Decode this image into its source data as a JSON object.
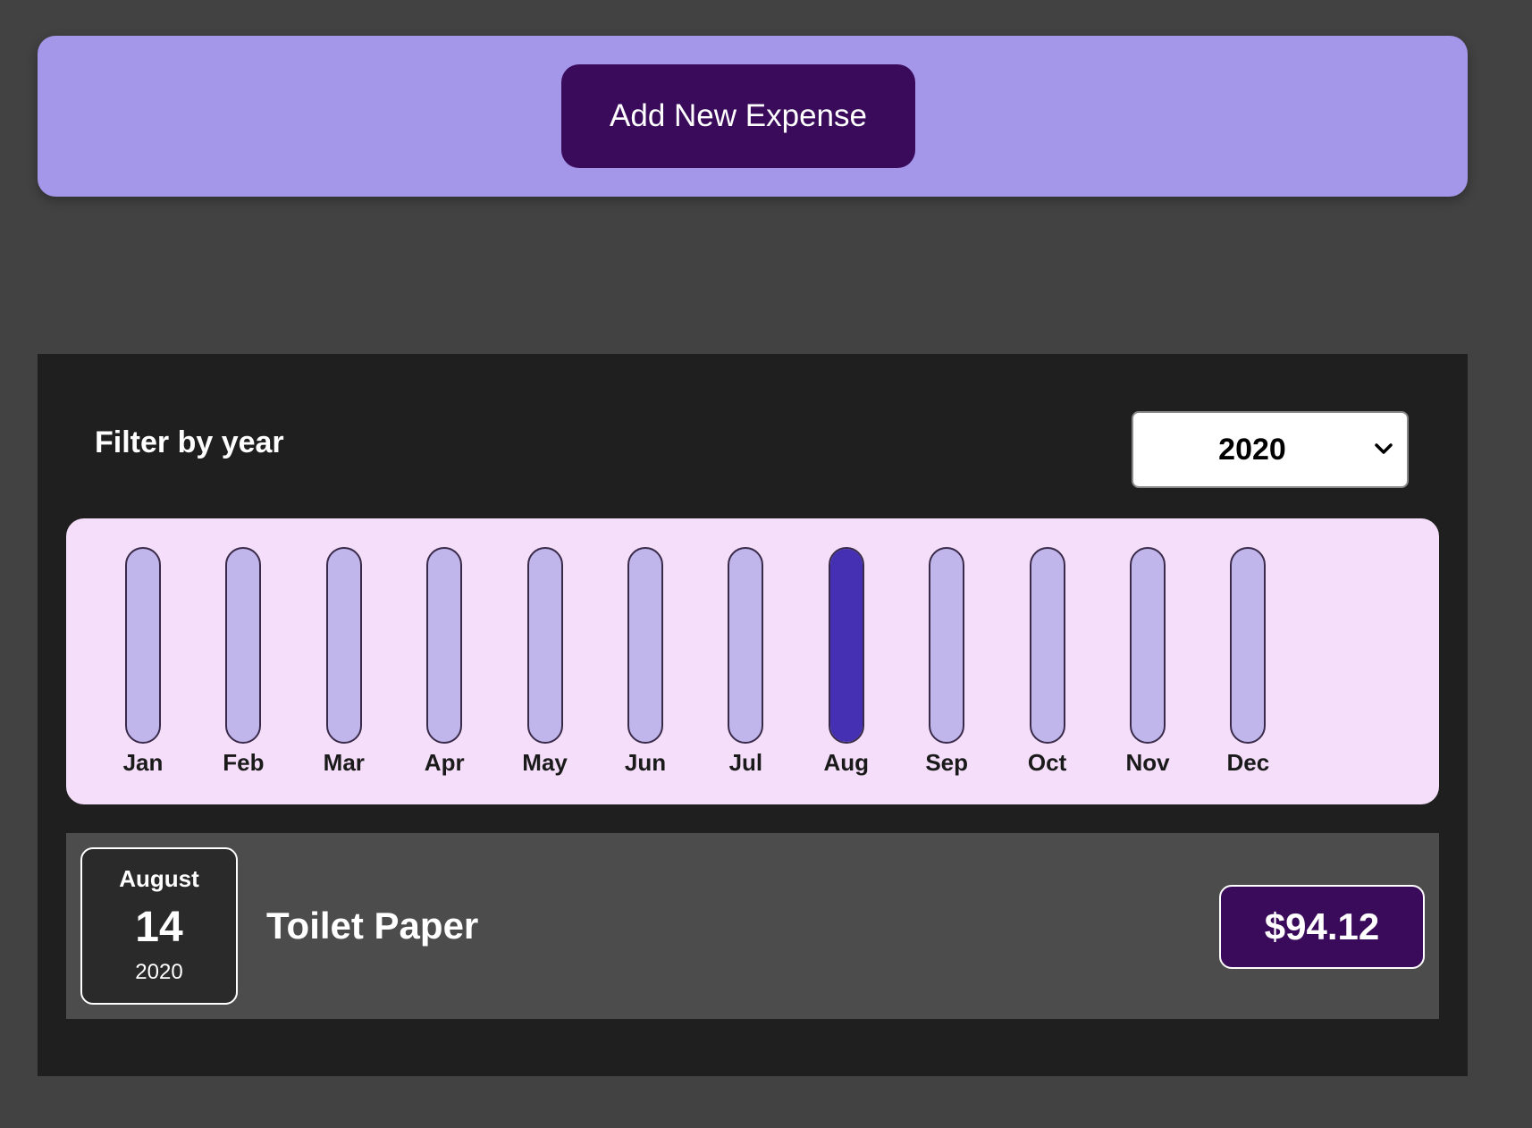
{
  "new_expense": {
    "button_label": "Add New Expense"
  },
  "filter": {
    "label": "Filter by year",
    "selected_year": "2020"
  },
  "chart_data": {
    "type": "bar",
    "categories": [
      "Jan",
      "Feb",
      "Mar",
      "Apr",
      "May",
      "Jun",
      "Jul",
      "Aug",
      "Sep",
      "Oct",
      "Nov",
      "Dec"
    ],
    "values": [
      0,
      0,
      0,
      0,
      0,
      0,
      0,
      94.12,
      0,
      0,
      0,
      0
    ],
    "ylim": [
      0,
      94.12
    ]
  },
  "expense_item": {
    "month": "August",
    "day": "14",
    "year": "2020",
    "title": "Toilet Paper",
    "amount": "$94.12"
  },
  "colors": {
    "background": "#424242",
    "new_expense_panel": "#a497e9",
    "button": "#3a0b5a",
    "chart_background": "#f4def9",
    "bar_track": "#c0b6ec",
    "bar_fill": "#4530b4"
  }
}
